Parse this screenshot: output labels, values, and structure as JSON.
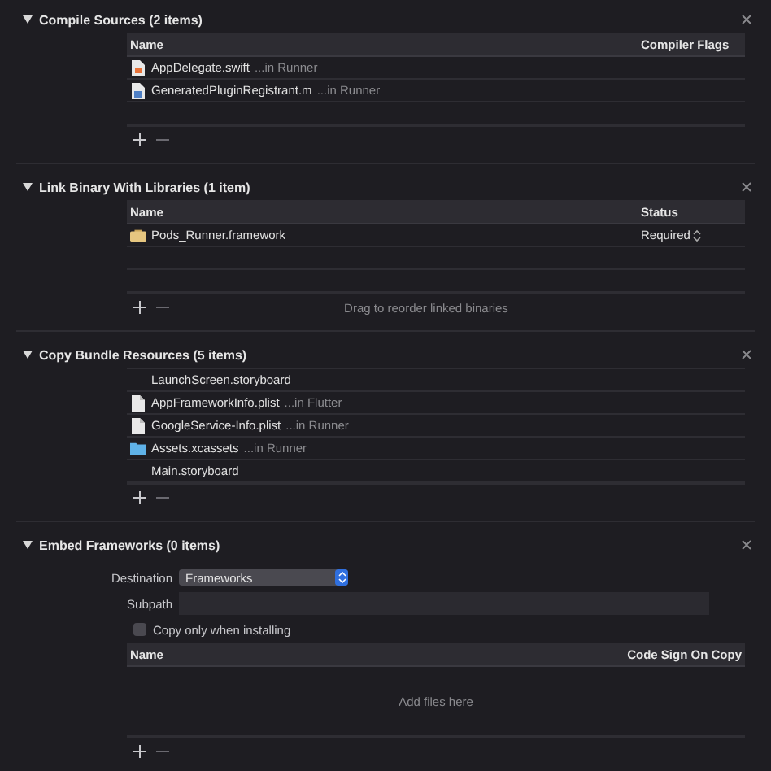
{
  "sections": [
    {
      "kind": "table",
      "title": "Compile Sources (2 items)",
      "expanded": true,
      "columns": [
        "Name",
        "Compiler Flags"
      ],
      "rows": [
        {
          "kind": "swift",
          "name": "AppDelegate.swift",
          "location": "...in Runner"
        },
        {
          "kind": "source",
          "name": "GeneratedPluginRegistrant.m",
          "location": "...in Runner"
        }
      ]
    },
    {
      "kind": "table",
      "title": "Link Binary With Libraries (1 item)",
      "expanded": true,
      "columns": [
        "Name",
        "Status"
      ],
      "rows": [
        {
          "kind": "framework",
          "name": "Pods_Runner.framework",
          "status": "Required"
        }
      ],
      "footer_hint": "Drag to reorder linked binaries"
    },
    {
      "kind": "list",
      "title": "Copy Bundle Resources (5 items)",
      "expanded": true,
      "rows": [
        {
          "kind": "plain",
          "name": "LaunchScreen.storyboard"
        },
        {
          "kind": "document",
          "name": "AppFrameworkInfo.plist",
          "location": "...in Flutter"
        },
        {
          "kind": "document",
          "name": "GoogleService-Info.plist",
          "location": "...in Runner"
        },
        {
          "kind": "folder",
          "name": "Assets.xcassets",
          "location": "...in Runner"
        },
        {
          "kind": "plain",
          "name": "Main.storyboard"
        }
      ]
    },
    {
      "kind": "embed",
      "title": "Embed Frameworks (0 items)",
      "expanded": true,
      "destination": {
        "label": "Destination",
        "value": "Frameworks"
      },
      "subpath": {
        "label": "Subpath"
      },
      "copy_only": {
        "label": "Copy only when installing",
        "checked": false
      },
      "columns": [
        "Name",
        "Code Sign On Copy"
      ],
      "empty_hint": "Add files here"
    }
  ]
}
